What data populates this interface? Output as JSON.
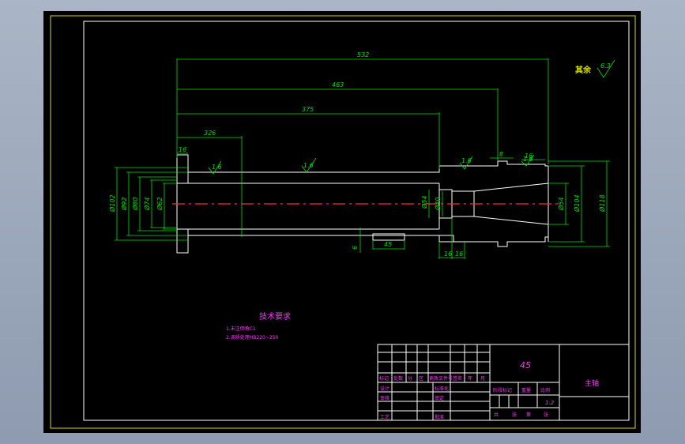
{
  "dimensions": {
    "total_length": "532",
    "len_463": "463",
    "len_375": "375",
    "len_326": "326",
    "step_16_left": "16",
    "gap_8": "8",
    "step_16_right": "16",
    "keyway_len": "45",
    "keyway_depth": "6",
    "step_16_bottom_a": "16",
    "step_16_bottom_b": "16",
    "dia_102": "Ø102",
    "dia_92": "Ø92",
    "dia_80": "Ø80",
    "dia_74": "Ø74",
    "dia_62": "Ø62",
    "dia_54": "Ø54",
    "dia_40": "Ø40",
    "dia_54_right": "Ø54",
    "dia_104": "Ø104",
    "dia_118": "Ø118"
  },
  "roughness": {
    "rest_label": "其余",
    "rest_value": "6.3",
    "marks": [
      "1.6",
      "1.6",
      "1.6",
      "1.6"
    ]
  },
  "tech_requirements": {
    "title": "技术要求",
    "items": [
      "1.未注倒角C1",
      "2.调质处理HB220~250"
    ]
  },
  "title_block": {
    "material": "45",
    "part_name": "主轴",
    "scale": "1:2",
    "headers": [
      "标记",
      "处数",
      "分",
      "区",
      "更改文件号",
      "签名",
      "年",
      "月",
      "日"
    ],
    "row_labels": [
      "设计",
      "审核",
      "工艺"
    ],
    "mid_labels": [
      "标准化",
      "审定",
      "批准"
    ],
    "right_headers": [
      "阶段标记",
      "重量",
      "比例"
    ],
    "sheet_info": [
      "共",
      "张",
      "第",
      "张"
    ]
  }
}
